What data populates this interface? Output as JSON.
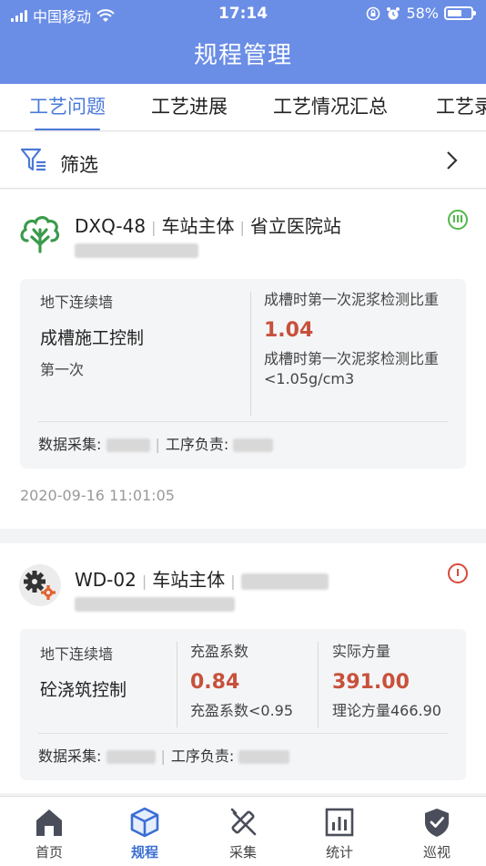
{
  "status_bar": {
    "carrier": "中国移动",
    "time": "17:14",
    "battery": "58%"
  },
  "header": {
    "title": "规程管理"
  },
  "tabs": [
    {
      "label": "工艺问题",
      "active": true
    },
    {
      "label": "工艺进展",
      "active": false
    },
    {
      "label": "工艺情况汇总",
      "active": false
    },
    {
      "label": "工艺录",
      "active": false
    }
  ],
  "filter": {
    "label": "筛选"
  },
  "cards": [
    {
      "code": "DXQ-48",
      "part": "车站主体",
      "station": "省立医院站",
      "level": "III",
      "level_color": "#53b84c",
      "category": "地下连续墙",
      "process": "成槽施工控制",
      "occurrence": "第一次",
      "metric_name": "成槽时第一次泥浆检测比重",
      "metric_value": "1.04",
      "metric_standard": "成槽时第一次泥浆检测比重<1.05g/cm3",
      "collector_label": "数据采集:",
      "owner_label": "工序负责:",
      "timestamp": "2020-09-16 11:01:05"
    },
    {
      "code": "WD-02",
      "part": "车站主体",
      "level": "I",
      "level_color": "#d94a3b",
      "category": "地下连续墙",
      "process": "砼浇筑控制",
      "metric1_name": "充盈系数",
      "metric1_value": "0.84",
      "metric1_standard": "充盈系数<0.95",
      "metric2_name": "实际方量",
      "metric2_value": "391.00",
      "metric2_standard": "理论方量466.90",
      "collector_label": "数据采集:",
      "owner_label": "工序负责:"
    }
  ],
  "tabbar": [
    {
      "label": "首页",
      "icon": "home-icon",
      "active": false
    },
    {
      "label": "规程",
      "icon": "cube-icon",
      "active": true
    },
    {
      "label": "采集",
      "icon": "tools-icon",
      "active": false
    },
    {
      "label": "统计",
      "icon": "chart-icon",
      "active": false
    },
    {
      "label": "巡视",
      "icon": "shield-icon",
      "active": false
    }
  ],
  "colors": {
    "header": "#6a8de6",
    "accent": "#4a78d8",
    "alert_value": "#c8513c"
  }
}
